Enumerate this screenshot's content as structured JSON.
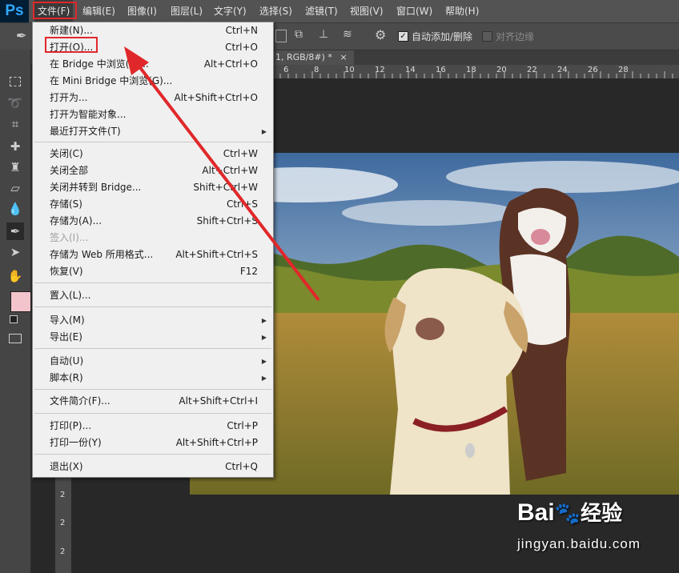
{
  "app": {
    "logo": "Ps"
  },
  "menubar": {
    "items": [
      "文件(F)",
      "编辑(E)",
      "图像(I)",
      "图层(L)",
      "文字(Y)",
      "选择(S)",
      "滤镜(T)",
      "视图(V)",
      "窗口(W)",
      "帮助(H)"
    ]
  },
  "options": {
    "auto_add_label": "自动添加/删除",
    "auto_add_checked": true,
    "align_edges_label": "对齐边缘",
    "align_edges_checked": false
  },
  "document_tab": {
    "title": "1, RGB/8#) *",
    "close": "×"
  },
  "ruler_top_labels": [
    "6",
    "8",
    "10",
    "12",
    "14",
    "16",
    "18",
    "20",
    "22",
    "24",
    "26",
    "28"
  ],
  "ruler_left_labels": [
    "2",
    "2",
    "2"
  ],
  "file_menu": {
    "groups": [
      [
        {
          "label": "新建(N)...",
          "shortcut": "Ctrl+N"
        },
        {
          "label": "打开(O)...",
          "shortcut": "Ctrl+O"
        },
        {
          "label": "在 Bridge 中浏览(B)...",
          "shortcut": "Alt+Ctrl+O"
        },
        {
          "label": "在 Mini Bridge 中浏览(G)...",
          "shortcut": ""
        },
        {
          "label": "打开为...",
          "shortcut": "Alt+Shift+Ctrl+O"
        },
        {
          "label": "打开为智能对象...",
          "shortcut": ""
        },
        {
          "label": "最近打开文件(T)",
          "shortcut": "",
          "submenu": true
        }
      ],
      [
        {
          "label": "关闭(C)",
          "shortcut": "Ctrl+W"
        },
        {
          "label": "关闭全部",
          "shortcut": "Alt+Ctrl+W"
        },
        {
          "label": "关闭并转到 Bridge...",
          "shortcut": "Shift+Ctrl+W"
        },
        {
          "label": "存储(S)",
          "shortcut": "Ctrl+S"
        },
        {
          "label": "存储为(A)...",
          "shortcut": "Shift+Ctrl+S"
        },
        {
          "label": "签入(I)...",
          "shortcut": "",
          "disabled": true
        },
        {
          "label": "存储为 Web 所用格式...",
          "shortcut": "Alt+Shift+Ctrl+S"
        },
        {
          "label": "恢复(V)",
          "shortcut": "F12"
        }
      ],
      [
        {
          "label": "置入(L)...",
          "shortcut": ""
        }
      ],
      [
        {
          "label": "导入(M)",
          "shortcut": "",
          "submenu": true
        },
        {
          "label": "导出(E)",
          "shortcut": "",
          "submenu": true
        }
      ],
      [
        {
          "label": "自动(U)",
          "shortcut": "",
          "submenu": true
        },
        {
          "label": "脚本(R)",
          "shortcut": "",
          "submenu": true
        }
      ],
      [
        {
          "label": "文件简介(F)...",
          "shortcut": "Alt+Shift+Ctrl+I"
        }
      ],
      [
        {
          "label": "打印(P)...",
          "shortcut": "Ctrl+P"
        },
        {
          "label": "打印一份(Y)",
          "shortcut": "Alt+Shift+Ctrl+P"
        }
      ],
      [
        {
          "label": "退出(X)",
          "shortcut": "Ctrl+Q"
        }
      ]
    ]
  },
  "annotation": {
    "color": "#e0282a"
  },
  "colors": {
    "foreground": "#f3c4cc",
    "ps_blue": "#31a8ff"
  },
  "watermark": {
    "brand": "Bai",
    "paw": "🐾",
    "brand2": "经验",
    "url": "jingyan.baidu.com"
  }
}
